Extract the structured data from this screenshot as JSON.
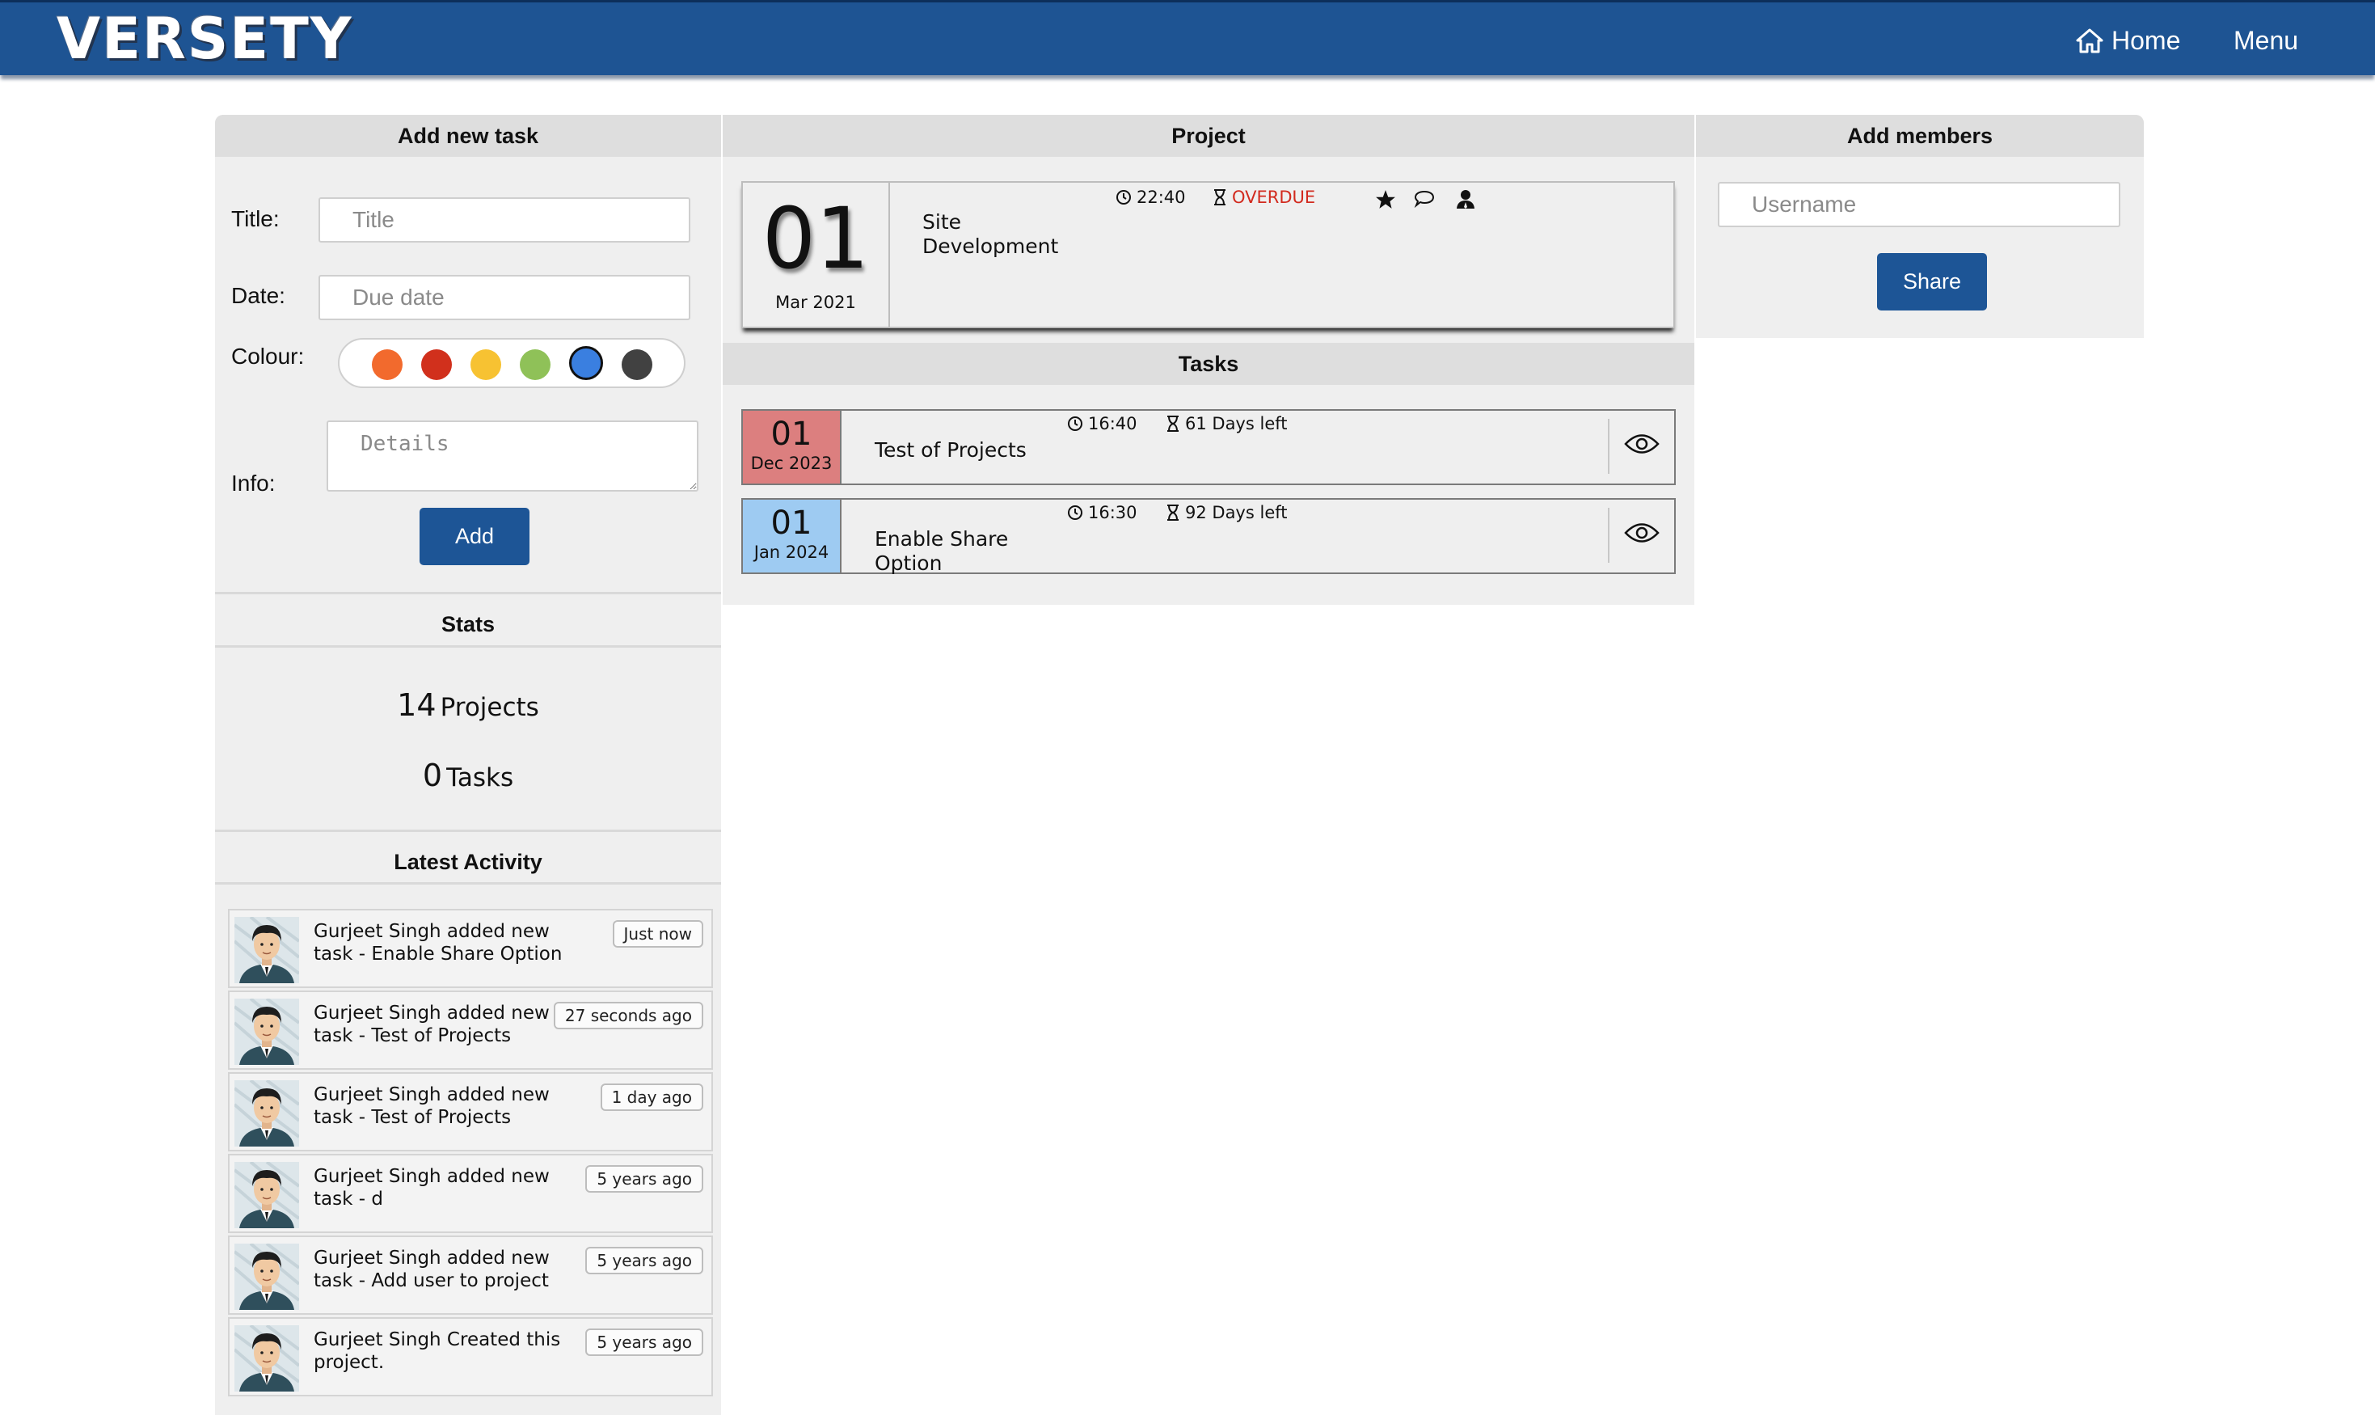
{
  "header": {
    "brand": "VERSETY",
    "nav": {
      "home": "Home",
      "menu": "Menu"
    },
    "brand_color": "#1e5493"
  },
  "add_task": {
    "heading": "Add new task",
    "title_label": "Title:",
    "title_placeholder": "Title",
    "date_label": "Date:",
    "date_placeholder": "Due date",
    "colour_label": "Colour:",
    "colours": [
      "#f26a2d",
      "#d1301c",
      "#f7c232",
      "#8fc158",
      "#3a7fe0",
      "#414141"
    ],
    "selected_colour": "#3a7fe0",
    "info_label": "Info:",
    "details_placeholder": "Details",
    "add_button": "Add"
  },
  "stats": {
    "heading": "Stats",
    "projects_count": "14",
    "projects_label": "Projects",
    "tasks_count": "0",
    "tasks_label": "Tasks"
  },
  "activity": {
    "heading": "Latest Activity",
    "items": [
      {
        "text": "Gurjeet Singh added new task - Enable Share Option",
        "time": "Just now"
      },
      {
        "text": "Gurjeet Singh added new task - Test of Projects",
        "time": "27 seconds ago"
      },
      {
        "text": "Gurjeet Singh added new task - Test of Projects",
        "time": "1 day ago"
      },
      {
        "text": "Gurjeet Singh added new task - d",
        "time": "5 years ago"
      },
      {
        "text": "Gurjeet Singh added new task - Add user to project",
        "time": "5 years ago"
      },
      {
        "text": "Gurjeet Singh Created this project.",
        "time": "5 years ago"
      }
    ]
  },
  "project": {
    "heading": "Project",
    "day": "01",
    "month": "Mar 2021",
    "title": "Site Development",
    "time": "22:40",
    "status": "OVERDUE",
    "status_color": "#d22a1e",
    "action_icons": [
      "star-icon",
      "comment-icon",
      "member-icon"
    ]
  },
  "tasks": {
    "heading": "Tasks",
    "items": [
      {
        "day": "01",
        "month": "Dec 2023",
        "title": "Test of Projects",
        "time": "16:40",
        "left": "61 Days left",
        "color": "#dc7f7f"
      },
      {
        "day": "01",
        "month": "Jan 2024",
        "title": "Enable Share Option",
        "time": "16:30",
        "left": "92 Days left",
        "color": "#9ecbf2"
      }
    ]
  },
  "members": {
    "heading": "Add members",
    "username_placeholder": "Username",
    "share_button": "Share"
  }
}
